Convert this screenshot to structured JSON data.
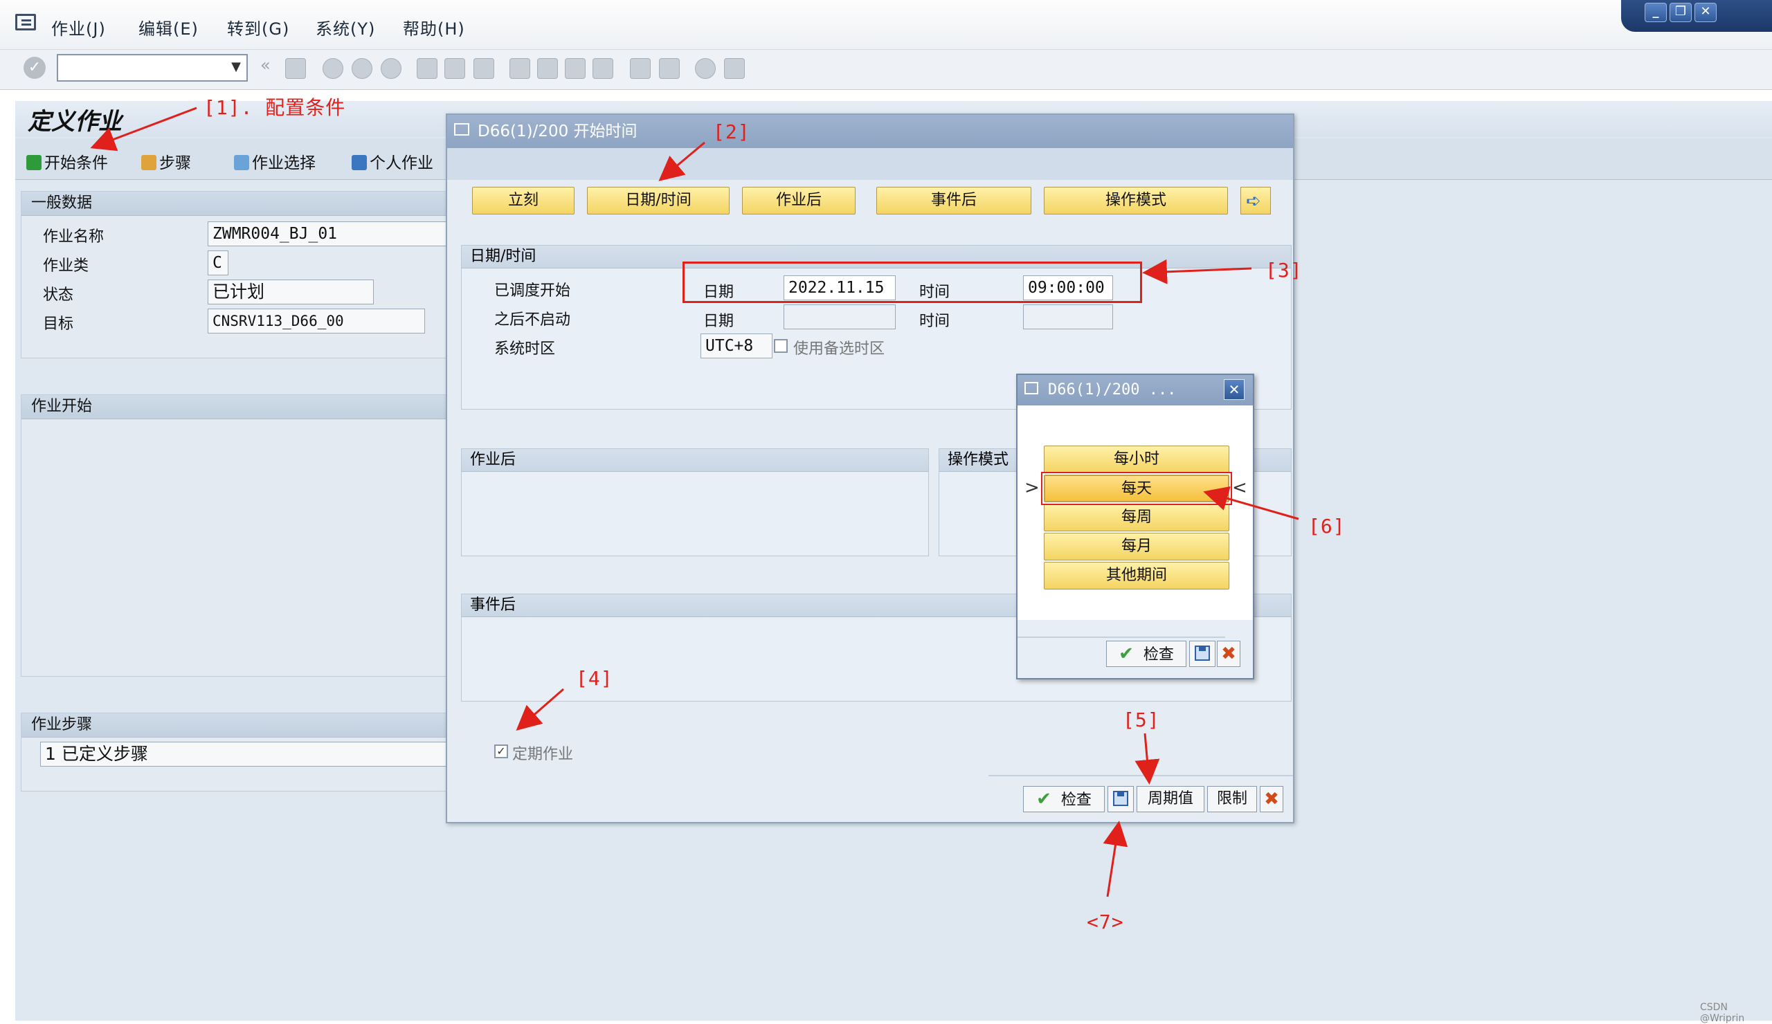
{
  "menubar": {
    "items": [
      "作业(J)",
      "编辑(E)",
      "转到(G)",
      "系统(Y)",
      "帮助(H)"
    ]
  },
  "window_controls": [
    "minimize",
    "restore",
    "close"
  ],
  "page": {
    "title": "定义作业",
    "toolbar": {
      "start_condition": "开始条件",
      "steps": "步骤",
      "job_selection": "作业选择",
      "own_jobs": "个人作业"
    },
    "general": {
      "header": "一般数据",
      "job_name_label": "作业名称",
      "job_name": "ZWMR004_BJ_01",
      "job_class_label": "作业类",
      "job_class": "C",
      "status_label": "状态",
      "status": "已计划",
      "target_label": "目标",
      "target": "CNSRV113_D66_00"
    },
    "job_start_header": "作业开始",
    "job_steps": {
      "header": "作业步骤",
      "value": "1  已定义步骤"
    }
  },
  "dialog": {
    "title": "D66(1)/200 开始时间",
    "buttons": {
      "immediate": "立刻",
      "date_time": "日期/时间",
      "after_job": "作业后",
      "after_event": "事件后",
      "operation_mode": "操作模式"
    },
    "datetime": {
      "header": "日期/时间",
      "scheduled_start": "已调度开始",
      "no_start_after": "之后不启动",
      "system_timezone": "系统时区",
      "date_label": "日期",
      "time_label": "时间",
      "date_value": "2022.11.15",
      "time_value": "09:00:00",
      "timezone_value": "UTC+8",
      "alt_timezone": "使用备选时区"
    },
    "after_job_header": "作业后",
    "operation_mode_header": "操作模式",
    "after_event_header": "事件后",
    "periodic_job": "定期作业",
    "footer": {
      "check": "检查",
      "period_values": "周期值",
      "restrictions": "限制"
    }
  },
  "popup": {
    "title": "D66(1)/200 ...",
    "options": [
      "每小时",
      "每天",
      "每周",
      "每月",
      "其他期间"
    ],
    "selected_index": 1,
    "check": "检查"
  },
  "annotations": {
    "a1": "[1]. 配置条件",
    "a2": "[2]",
    "a3": "[3]",
    "a4": "[4]",
    "a5": "[5]",
    "a6": "[6]",
    "a7": "<7>"
  },
  "colors": {
    "annotation_red": "#e0201a",
    "button_yellow": "#f4d463",
    "title_blue": "#8ea4c3"
  },
  "credit": "CSDN @Wriprin"
}
